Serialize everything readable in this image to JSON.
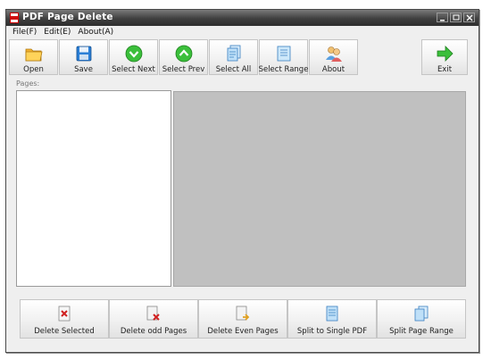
{
  "window": {
    "title": "PDF Page Delete",
    "controls": [
      "minimize-icon",
      "maximize-icon",
      "close-icon"
    ]
  },
  "menu": [
    {
      "label": "File(F)"
    },
    {
      "label": "Edit(E)"
    },
    {
      "label": "About(A)"
    }
  ],
  "toolbar": [
    {
      "label": "Open",
      "icon": "folder-icon"
    },
    {
      "label": "Save",
      "icon": "floppy-icon"
    },
    {
      "label": "Select Next",
      "icon": "arrow-down-circle-icon"
    },
    {
      "label": "Select Prev",
      "icon": "arrow-up-circle-icon"
    },
    {
      "label": "Select All",
      "icon": "pages-stack-icon"
    },
    {
      "label": "Select Range",
      "icon": "page-range-icon"
    },
    {
      "label": "About",
      "icon": "people-icon"
    }
  ],
  "exit": {
    "label": "Exit",
    "icon": "green-arrow-right-icon"
  },
  "pages_label": "Pages:",
  "bottom_buttons": [
    {
      "label": "Delete Selected",
      "icon": "page-delete-icon"
    },
    {
      "label": "Delete odd Pages",
      "icon": "page-odd-delete-icon"
    },
    {
      "label": "Delete Even Pages",
      "icon": "page-even-delete-icon"
    },
    {
      "label": "Split to Single PDF",
      "icon": "split-single-icon"
    },
    {
      "label": "Split Page Range",
      "icon": "split-range-icon"
    }
  ],
  "colors": {
    "title_bar": "#3f3f3f",
    "preview_bg": "#c0c0c0",
    "list_bg": "#ffffff",
    "accent_green": "#3bbf3b"
  }
}
